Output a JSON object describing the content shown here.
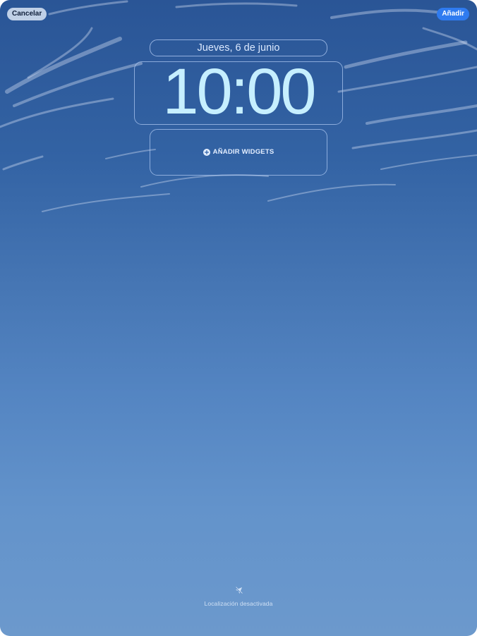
{
  "toolbar": {
    "cancel_label": "Cancelar",
    "add_label": "Añadir"
  },
  "lockscreen": {
    "date": "Jueves, 6 de junio",
    "time": "10:00",
    "widgets_label": "AÑADIR WIDGETS"
  },
  "footer": {
    "location_label": "Localización desactivada",
    "location_icon": "location-off-icon"
  },
  "colors": {
    "accent": "#2f7bf0",
    "time_text": "#c6efff",
    "sky_top": "#2a5596",
    "sky_bottom": "#6c99cc"
  }
}
